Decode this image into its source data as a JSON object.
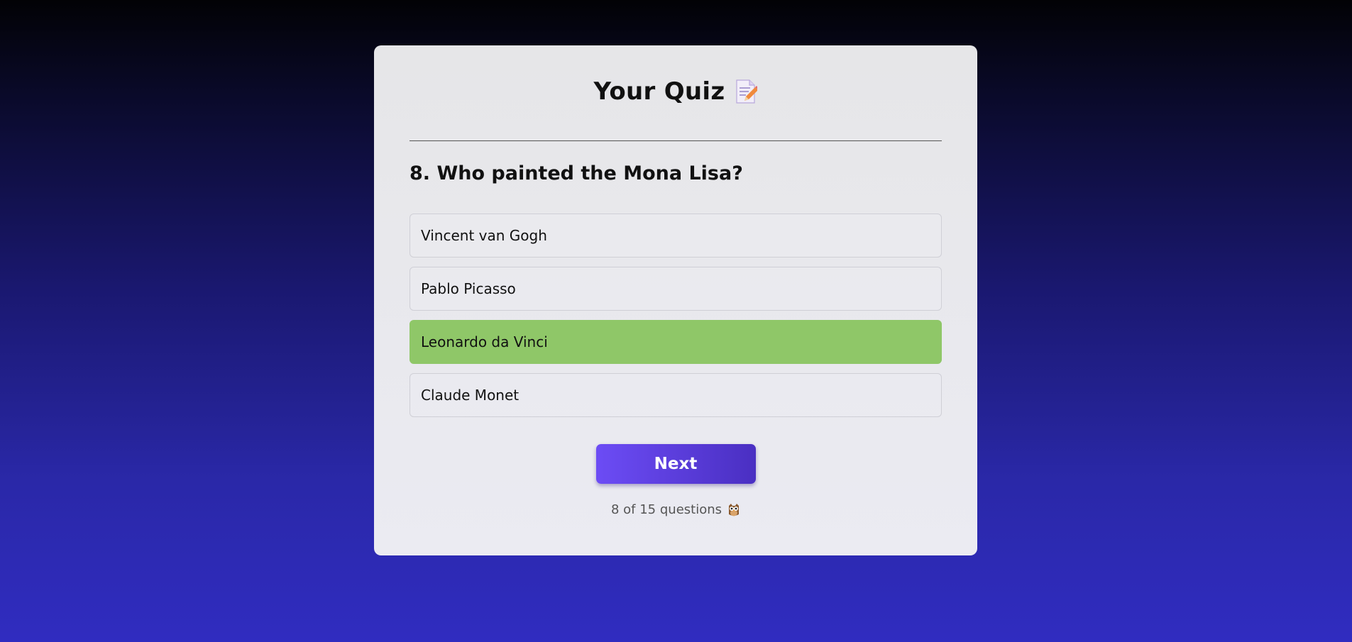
{
  "quiz": {
    "title": "Your Quiz",
    "title_icon": "memo-icon",
    "question": "8. Who painted the Mona Lisa?",
    "options": [
      {
        "label": "Vincent van Gogh",
        "state": "default"
      },
      {
        "label": "Pablo Picasso",
        "state": "default"
      },
      {
        "label": "Leonardo da Vinci",
        "state": "correct"
      },
      {
        "label": "Claude Monet",
        "state": "default"
      }
    ],
    "next_label": "Next",
    "progress_text": "8 of 15 questions",
    "progress_icon": "owl-icon"
  },
  "colors": {
    "correct": "#8fc768",
    "button_start": "#6c4cf5",
    "button_end": "#4a2fc2"
  }
}
